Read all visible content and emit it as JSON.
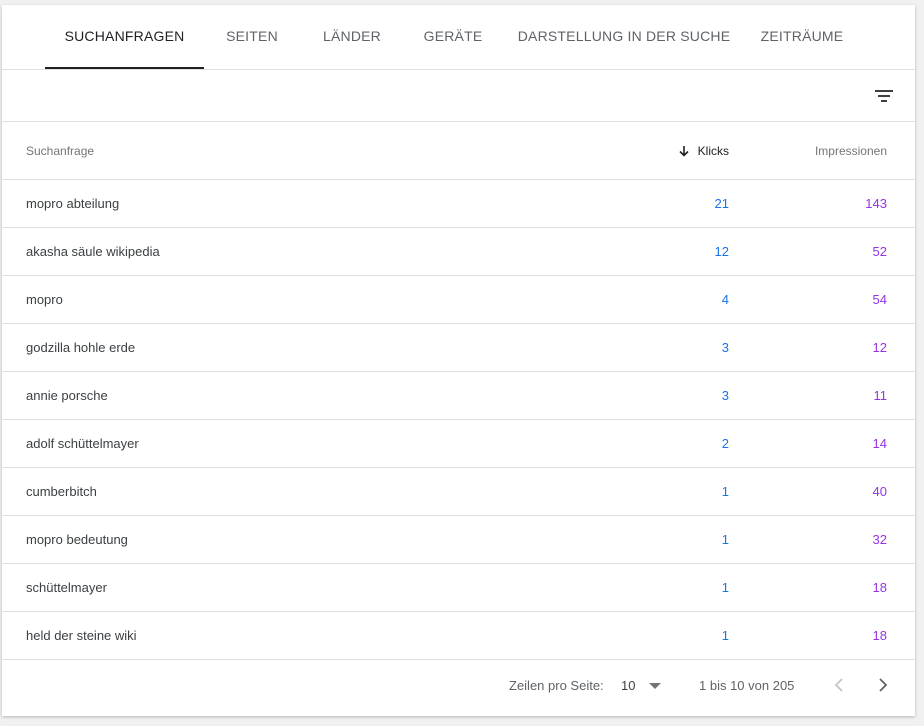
{
  "tabs": [
    {
      "label": "SUCHANFRAGEN",
      "active": true
    },
    {
      "label": "SEITEN"
    },
    {
      "label": "LÄNDER"
    },
    {
      "label": "GERÄTE"
    },
    {
      "label": "DARSTELLUNG IN DER SUCHE"
    },
    {
      "label": "ZEITRÄUME"
    }
  ],
  "toolbar": {
    "filter_icon": "filter-list-icon"
  },
  "table": {
    "headers": {
      "query": "Suchanfrage",
      "clicks": "Klicks",
      "impressions": "Impressionen"
    },
    "sort_icon": "arrow-down-icon",
    "rows": [
      {
        "query": "mopro abteilung",
        "clicks": "21",
        "impressions": "143"
      },
      {
        "query": "akasha säule wikipedia",
        "clicks": "12",
        "impressions": "52"
      },
      {
        "query": "mopro",
        "clicks": "4",
        "impressions": "54"
      },
      {
        "query": "godzilla hohle erde",
        "clicks": "3",
        "impressions": "12"
      },
      {
        "query": "annie porsche",
        "clicks": "3",
        "impressions": "11"
      },
      {
        "query": "adolf schüttelmayer",
        "clicks": "2",
        "impressions": "14"
      },
      {
        "query": "cumberbitch",
        "clicks": "1",
        "impressions": "40"
      },
      {
        "query": "mopro bedeutung",
        "clicks": "1",
        "impressions": "32"
      },
      {
        "query": "schüttelmayer",
        "clicks": "1",
        "impressions": "18"
      },
      {
        "query": "held der steine wiki",
        "clicks": "1",
        "impressions": "18"
      }
    ]
  },
  "pagination": {
    "rows_per_page_label": "Zeilen pro Seite:",
    "rows_per_page_value": "10",
    "range_text": "1 bis 10 von 205"
  },
  "colors": {
    "clicks": "#1a73e8",
    "impressions": "#9334e6",
    "active_tab": "#202124"
  }
}
